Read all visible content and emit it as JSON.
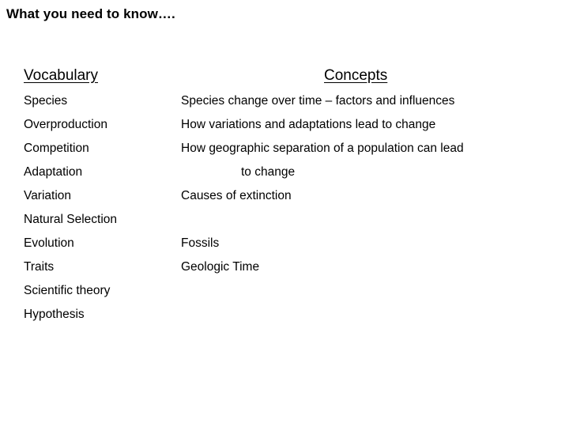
{
  "slide": {
    "title": "What you need to know….",
    "background_color": "#ffffff",
    "text_color": "#000000"
  },
  "columns": {
    "vocabulary": {
      "heading": "Vocabulary",
      "items": [
        "Species",
        "Overproduction",
        "Competition",
        "Adaptation",
        "Variation",
        "Natural Selection",
        "Evolution",
        "Traits",
        "Scientific theory",
        "Hypothesis"
      ]
    },
    "concepts": {
      "heading": "Concepts",
      "items": [
        "Species change over time – factors and influences",
        "How variations and adaptations lead to change",
        "How geographic separation of a population can lead",
        "to change",
        "Causes of extinction",
        "",
        "Fossils",
        "Geologic Time"
      ]
    }
  }
}
